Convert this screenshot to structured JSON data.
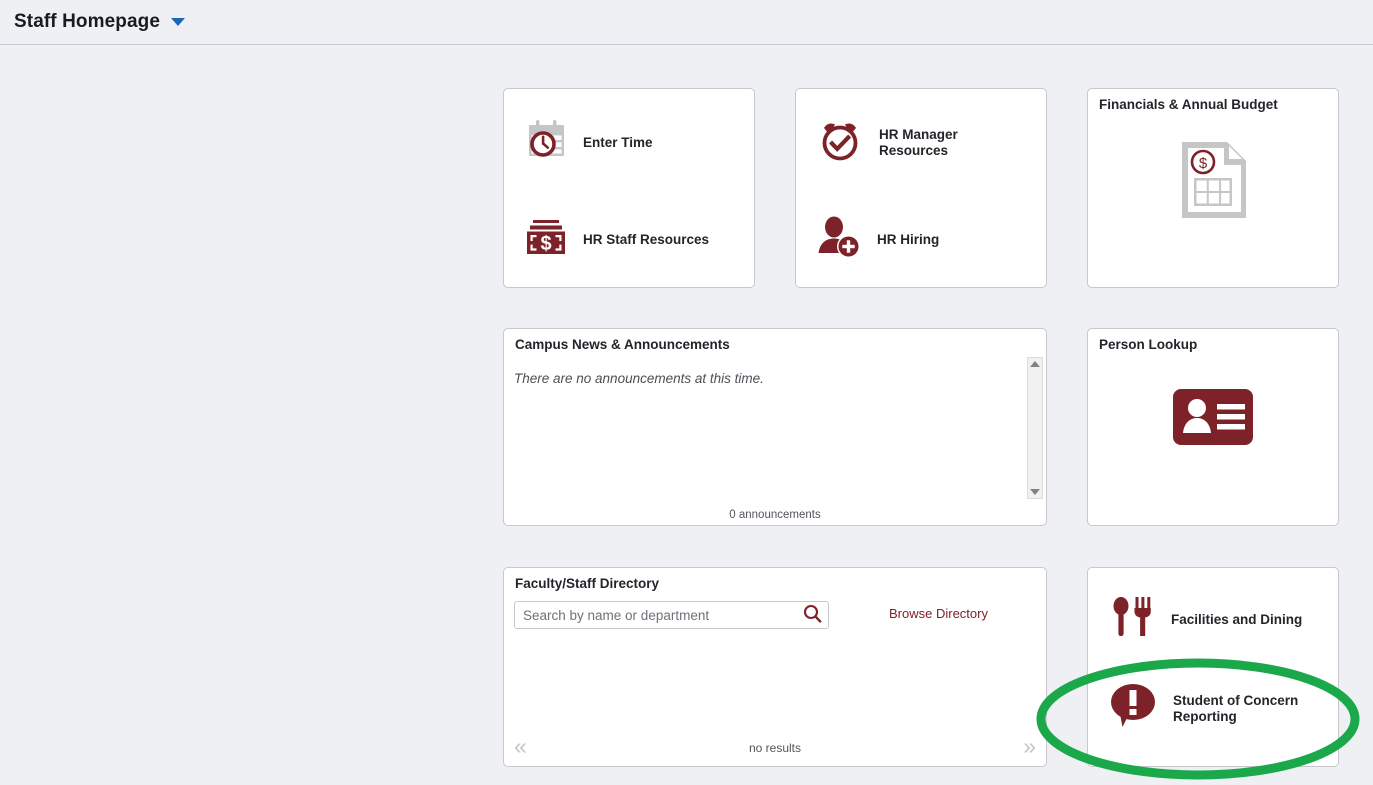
{
  "header": {
    "title": "Staff Homepage",
    "caret_icon": "chevron-down-icon"
  },
  "theme": {
    "accent": "#7c2228",
    "page_bg": "#eff0f3",
    "tile_bg": "#ffffff",
    "tile_border": "#c6c8cc",
    "text": "#23252b",
    "annotation_green": "#1aa84a",
    "caret_blue": "#1b67b3",
    "icon_gray": "#c6c6c6"
  },
  "tiles": {
    "time_resources": {
      "links": [
        {
          "label": "Enter Time",
          "icon": "calendar-clock-icon"
        },
        {
          "label": "HR Staff Resources",
          "icon": "money-stack-icon"
        }
      ]
    },
    "hr": {
      "links": [
        {
          "label": "HR Manager\nResources",
          "icon": "alarm-clock-check-icon"
        },
        {
          "label": "HR Hiring",
          "icon": "person-add-icon"
        }
      ]
    },
    "financials": {
      "title": "Financials & Annual Budget",
      "icon": "document-dollar-grid-icon"
    },
    "news": {
      "title": "Campus News & Announcements",
      "empty_message": "There are no announcements at this time.",
      "footer": "0 announcements",
      "scrollbar": {
        "up_icon": "scroll-up-arrow-icon",
        "down_icon": "scroll-down-arrow-icon"
      }
    },
    "person_lookup": {
      "title": "Person Lookup",
      "icon": "id-card-icon"
    },
    "directory": {
      "title": "Faculty/Staff Directory",
      "search_placeholder": "Search by name or department",
      "search_value": "",
      "search_icon": "magnifier-icon",
      "browse_label": "Browse Directory",
      "footer": "no results",
      "prev_icon": "double-chevron-left-icon",
      "next_icon": "double-chevron-right-icon",
      "prev_label": "«",
      "next_label": "»"
    },
    "services": {
      "links": [
        {
          "label": "Facilities and Dining",
          "icon": "spoon-fork-icon"
        },
        {
          "label": "Student of Concern\nReporting",
          "icon": "speech-bubble-alert-icon"
        }
      ]
    }
  },
  "annotation": {
    "shape": "ellipse-highlight",
    "target": "Student of Concern Reporting",
    "color": "#1aa84a"
  }
}
